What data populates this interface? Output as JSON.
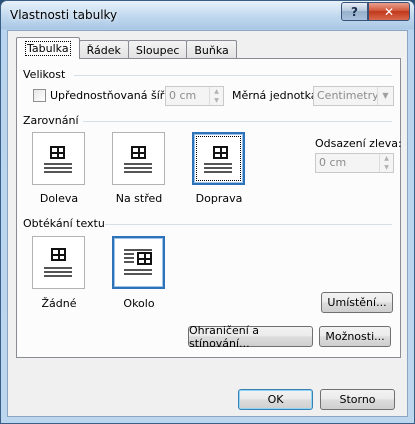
{
  "window": {
    "title": "Vlastnosti tabulky",
    "help_glyph": "?",
    "close_glyph": "✕"
  },
  "tabs": [
    {
      "label": "Tabulka",
      "active": true
    },
    {
      "label": "Řádek",
      "active": false
    },
    {
      "label": "Sloupec",
      "active": false
    },
    {
      "label": "Buňka",
      "active": false
    }
  ],
  "size": {
    "section_label": "Velikost",
    "preferred_width_label": "Upřednostňovaná šířka:",
    "preferred_width_value": "0 cm",
    "preferred_width_checked": false,
    "unit_label": "Měrná jednotka:",
    "unit_value": "Centimetry"
  },
  "alignment": {
    "section_label": "Zarovnání",
    "options": [
      {
        "label": "Doleva",
        "selected": false
      },
      {
        "label": "Na střed",
        "selected": false
      },
      {
        "label": "Doprava",
        "selected": true
      }
    ],
    "indent_label": "Odsazení zleva:",
    "indent_value": "0 cm"
  },
  "text_wrapping": {
    "section_label": "Obtékání textu",
    "options": [
      {
        "label": "Žádné",
        "selected": false
      },
      {
        "label": "Okolo",
        "selected": true
      }
    ],
    "positioning_button": "Umístění..."
  },
  "footer": {
    "borders_button": "Ohraničení a stínování...",
    "options_button": "Možnosti...",
    "ok_button": "OK",
    "cancel_button": "Storno"
  },
  "colors": {
    "accent": "#2e73b8",
    "close_button": "#c0391b"
  }
}
